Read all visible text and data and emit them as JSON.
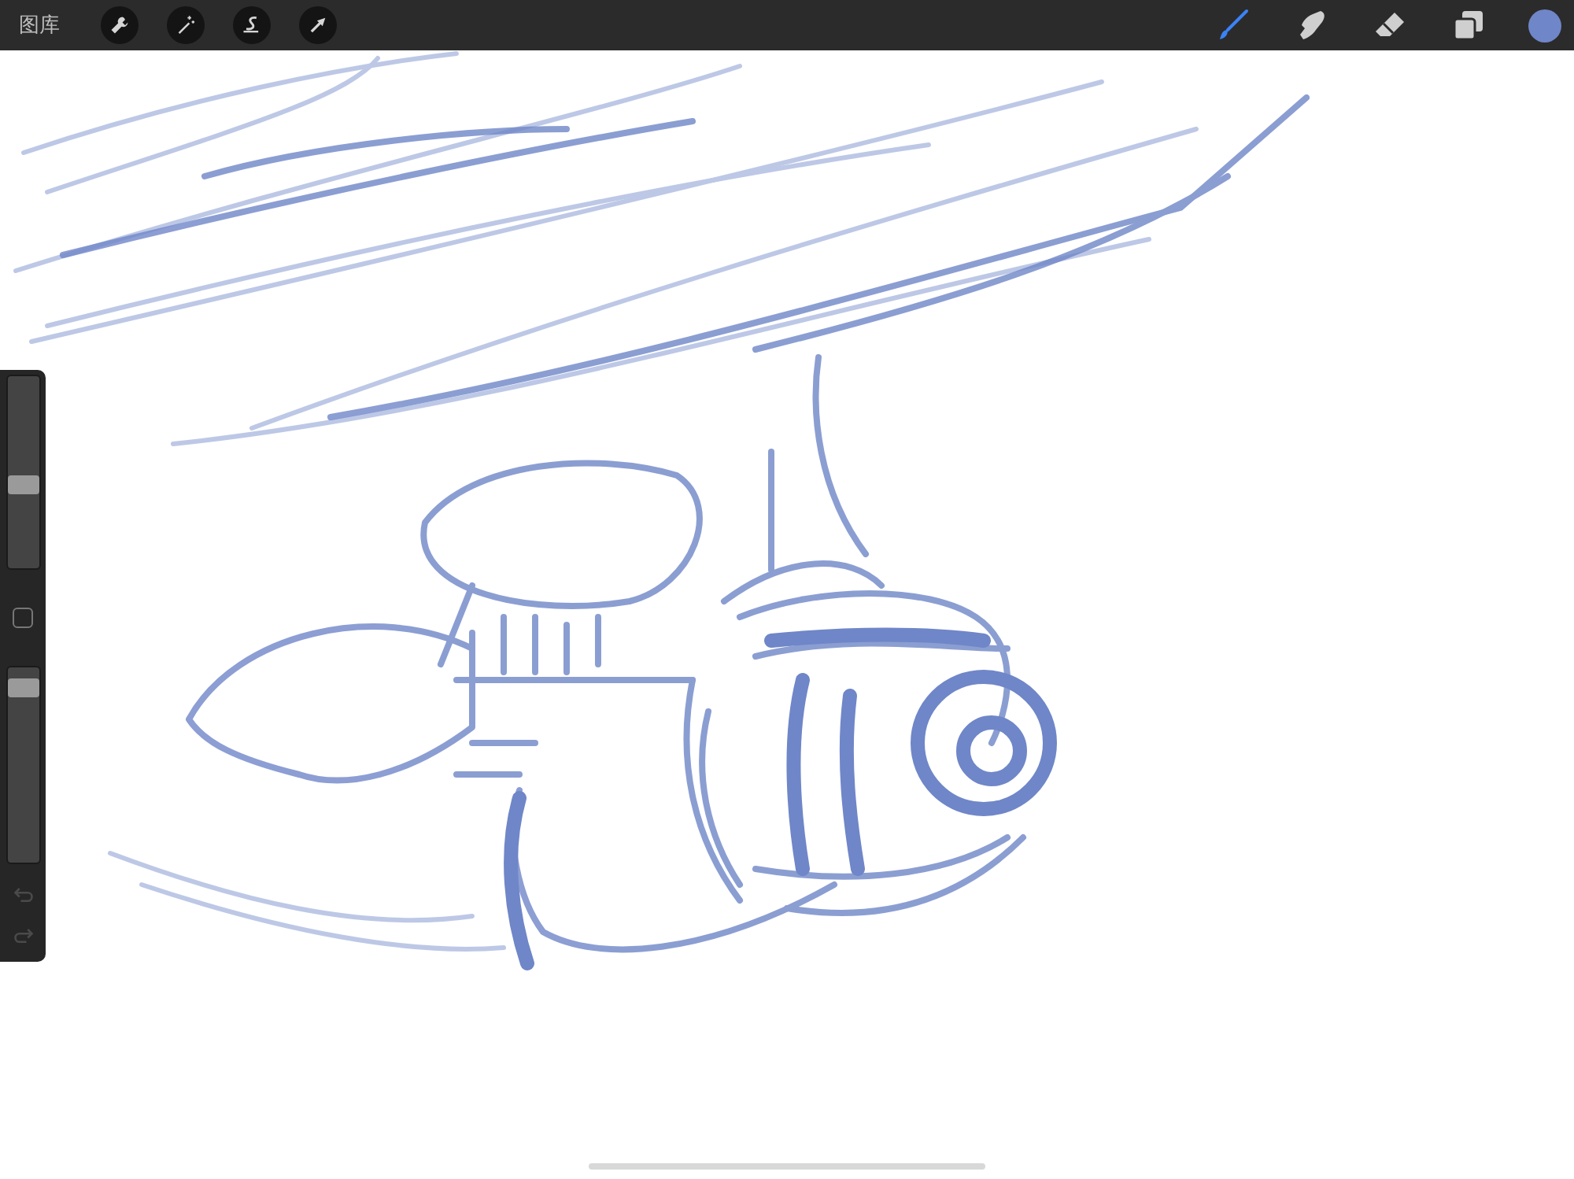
{
  "top_bar": {
    "gallery_label": "图库",
    "left_tools": [
      {
        "kind": "wrench"
      },
      {
        "kind": "wand"
      },
      {
        "kind": "selection"
      },
      {
        "kind": "arrow"
      }
    ],
    "right_tools": [
      {
        "kind": "brush",
        "selected": true
      },
      {
        "kind": "smudge",
        "selected": false
      },
      {
        "kind": "eraser",
        "selected": false
      },
      {
        "kind": "layers",
        "selected": false
      }
    ],
    "color": "#6f86c8"
  },
  "sidebar": {
    "size_slider": {
      "level": 0.43
    },
    "opacity_slider": {
      "level": 0.94
    },
    "undo": {
      "disabled": true
    },
    "redo": {
      "disabled": true
    }
  }
}
